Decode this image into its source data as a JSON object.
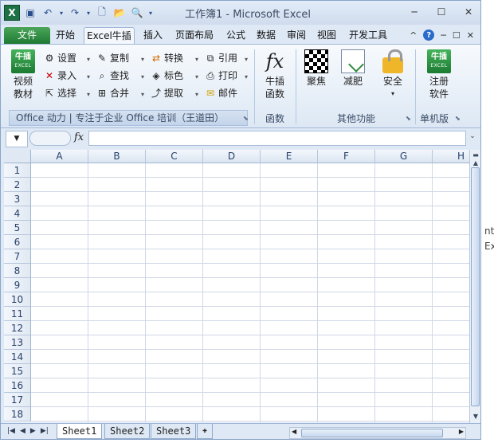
{
  "window": {
    "title": "工作簿1 - Microsoft Excel",
    "controls": [
      "─",
      "☐",
      "✕"
    ]
  },
  "tabs": [
    "文件",
    "开始",
    "Excel牛插",
    "插入",
    "页面布局",
    "公式",
    "数据",
    "审阅",
    "视图",
    "开发工具"
  ],
  "ribbon_right": [
    "^",
    "?",
    "─",
    "☐",
    "✕"
  ],
  "ribbon": {
    "video": {
      "line1": "视频",
      "line2": "教材",
      "icon_text": "牛插",
      "icon_sub": "EXCEL"
    },
    "small_col1": [
      "设置",
      "录入",
      "选择"
    ],
    "small_col2": [
      "复制",
      "查找",
      "合并"
    ],
    "small_col3": [
      "转换",
      "标色",
      "提取"
    ],
    "small_col4": [
      "引用",
      "打印",
      "邮件"
    ],
    "func": {
      "line1": "牛插",
      "line2": "函数",
      "icon": "fx"
    },
    "focus": "聚焦",
    "slim": "减肥",
    "security": "安全",
    "register": {
      "line1": "注册",
      "line2": "软件",
      "icon_text": "牛插",
      "icon_sub": "EXCEL"
    },
    "groups": {
      "banner": "Office 动力 | 专注于企业 Office 培训（王道田）",
      "func": "函数",
      "other": "其他功能",
      "single": "单机版"
    }
  },
  "formula_bar": {
    "fx": "fx",
    "value": ""
  },
  "columns": [
    "A",
    "B",
    "C",
    "D",
    "E",
    "F",
    "G",
    "H"
  ],
  "rows": [
    "1",
    "2",
    "3",
    "4",
    "5",
    "6",
    "7",
    "8",
    "9",
    "10",
    "11",
    "12",
    "13",
    "14",
    "15",
    "16",
    "17",
    "18"
  ],
  "sheets": [
    "Sheet1",
    "Sheet2",
    "Sheet3"
  ],
  "side_text": [
    "nt",
    "Ex"
  ]
}
